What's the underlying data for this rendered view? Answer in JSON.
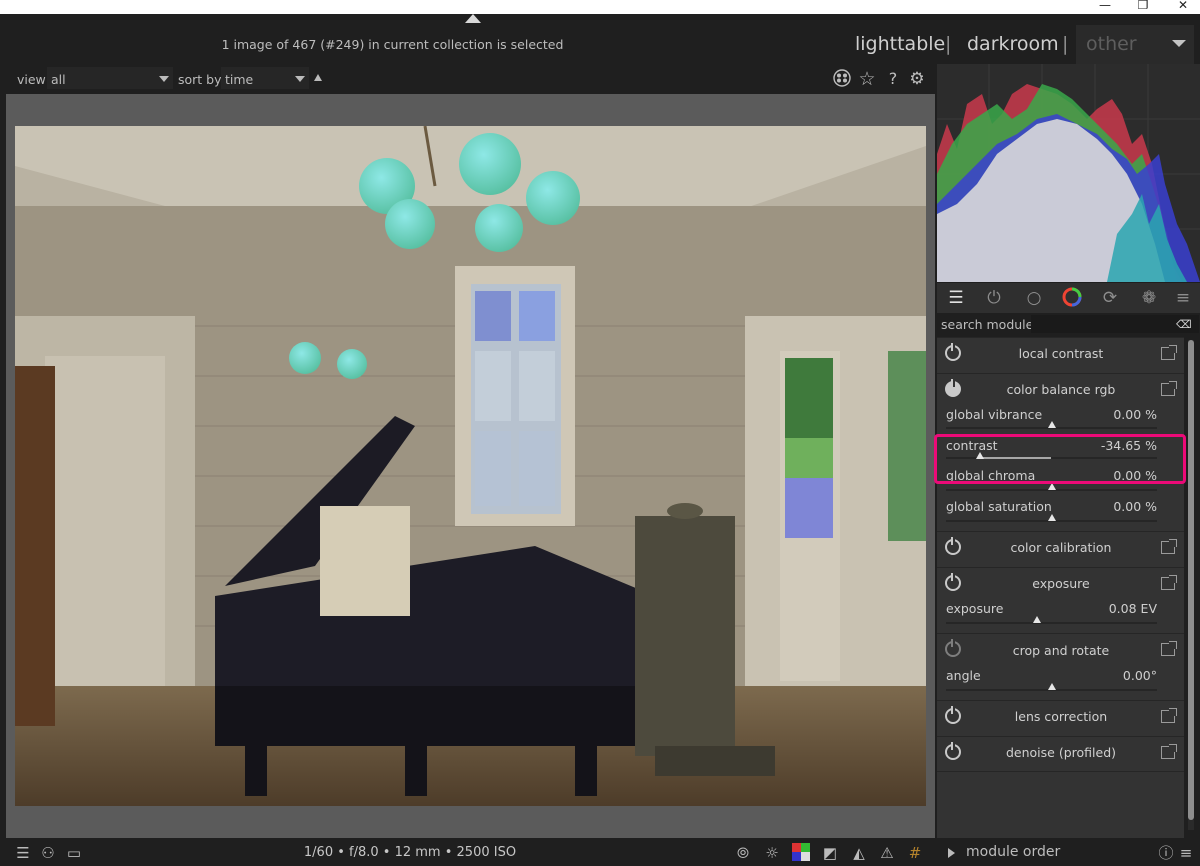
{
  "window": {
    "minimize_icon": "minimize-icon",
    "restore_icon": "restore-icon",
    "close_icon": "close-icon"
  },
  "header": {
    "collection_status": "1 image of 467 (#249) in current collection is selected",
    "views": {
      "lighttable": "lighttable",
      "separator": "|",
      "darkroom": "darkroom",
      "other": "other"
    }
  },
  "filter": {
    "view_label": "view",
    "view_value": "all",
    "sort_label": "sort by",
    "sort_value": "time",
    "icons": [
      "color-labels-icon",
      "star-icon",
      "help-icon",
      "gear-icon"
    ]
  },
  "modules": {
    "search_label": "search module",
    "search_value": "",
    "group_tabs": [
      "quick-access-icon",
      "active-modules-icon",
      "base-group-icon",
      "color-group-icon",
      "correct-group-icon",
      "effect-group-icon",
      "presets-menu-icon"
    ],
    "local_contrast": {
      "name": "local contrast"
    },
    "color_balance": {
      "name": "color balance rgb",
      "sliders": [
        {
          "label": "global vibrance",
          "value": "0.00 %",
          "level": 0.5
        },
        {
          "label": "contrast",
          "value": "-34.65 %",
          "level": 0.16
        },
        {
          "label": "global chroma",
          "value": "0.00 %",
          "level": 0.5
        },
        {
          "label": "global saturation",
          "value": "0.00 %",
          "level": 0.5
        }
      ]
    },
    "color_calibration": {
      "name": "color calibration"
    },
    "exposure": {
      "name": "exposure",
      "slider_label": "exposure",
      "slider_value": "0.08 EV",
      "level": 0.43
    },
    "crop": {
      "name": "crop and rotate",
      "slider_label": "angle",
      "slider_value": "0.00°",
      "level": 0.5
    },
    "lens": {
      "name": "lens correction"
    },
    "denoise": {
      "name": "denoise (profiled)"
    }
  },
  "bottom": {
    "exif": "1/60 • f/8.0 • 12 mm • 2500 ISO",
    "module_order": "module order",
    "highlight_color": "#ec0a78"
  }
}
